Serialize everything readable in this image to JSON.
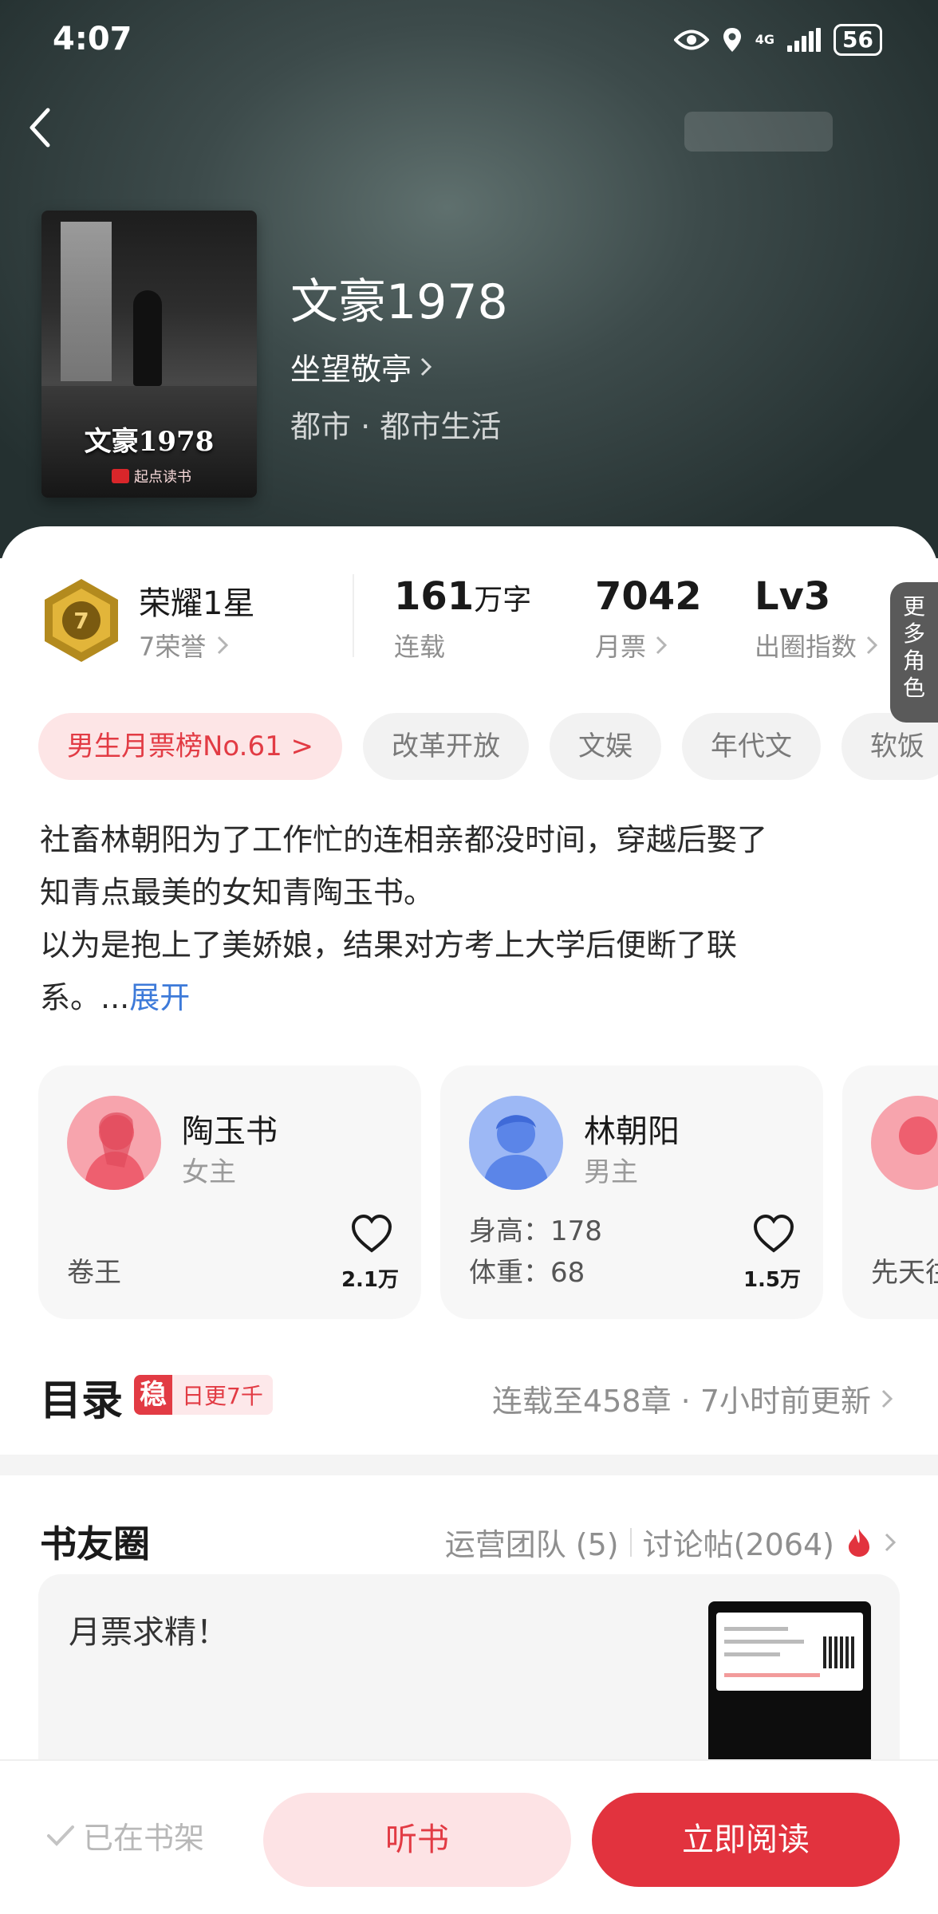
{
  "status_bar": {
    "time": "4:07",
    "network": "4G",
    "battery": "56"
  },
  "book": {
    "cover_title": "文豪1978",
    "cover_brand": "起点读书",
    "title": "文豪1978",
    "author": "坐望敬亭",
    "category": "都市 · 都市生活"
  },
  "stats": {
    "honor_title": "荣耀1星",
    "honor_sub": "7荣誉",
    "medal_number": "7",
    "words_value": "161",
    "words_unit": "万字",
    "words_label": "连载",
    "monthly_votes_value": "7042",
    "monthly_votes_label": "月票",
    "index_value": "Lv3",
    "index_label": "出圈指数"
  },
  "tags": [
    "男生月票榜No.61 >",
    "改革开放",
    "文娱",
    "年代文",
    "软饭"
  ],
  "synopsis": {
    "line1": "社畜林朝阳为了工作忙的连相亲都没时间，穿越后娶了",
    "line2": "知青点最美的女知青陶玉书。",
    "line3": "以为是抱上了美娇娘，结果对方考上大学后便断了联",
    "line4": "系。...",
    "expand": "展开"
  },
  "characters": [
    {
      "name": "陶玉书",
      "role": "女主",
      "trait": "卷王",
      "likes": "2.1万"
    },
    {
      "name": "林朝阳",
      "role": "男主",
      "height": "身高：178",
      "weight": "体重：68",
      "likes": "1.5万"
    },
    {
      "trait": "先天往"
    }
  ],
  "more_roles": "更多角色",
  "toc": {
    "title": "目录",
    "badge_char": "稳",
    "badge_text": "日更7千",
    "status": "连载至458章 · 7小时前更新"
  },
  "circle": {
    "title": "书友圈",
    "team": "运营团队 (5)",
    "posts": "讨论帖(2064)",
    "post_text": "月票求精！"
  },
  "bottom_bar": {
    "shelf": "已在书架",
    "listen": "听书",
    "read": "立即阅读"
  },
  "colors": {
    "accent": "#e2333e",
    "accent_light": "#fde3e5",
    "link": "#3d7ad9",
    "hero_bg": "#3d4b4b"
  }
}
